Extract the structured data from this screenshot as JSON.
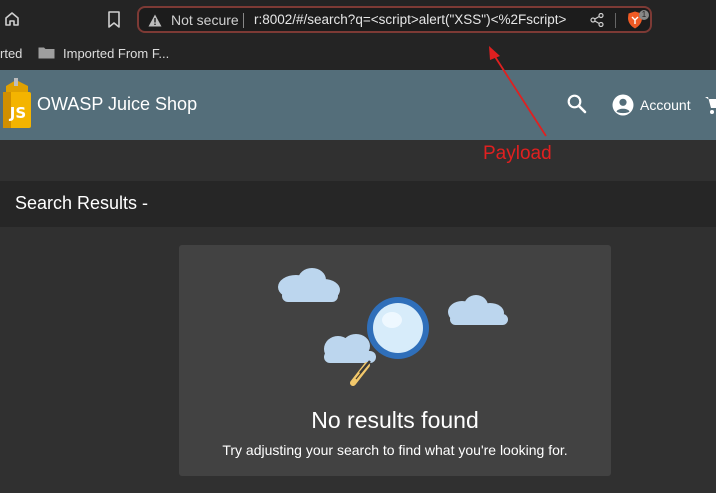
{
  "browser": {
    "security_label": "Not secure",
    "url": "r:8002/#/search?q=<script>alert(\"XSS\")<%2Fscript>",
    "shields_badge": "1",
    "bookmarks": {
      "partial_item": "rted",
      "folder_label": "Imported From F..."
    }
  },
  "app": {
    "title": "OWASP Juice Shop",
    "logo_text": "JS",
    "account_label": "Account",
    "toolbar_color": "#546e7a"
  },
  "annotation": {
    "label": "Payload",
    "color": "#e02020"
  },
  "results": {
    "heading": "Search Results -",
    "empty_title": "No results found",
    "empty_subtitle": "Try adjusting your search to find what you're looking for."
  },
  "icons": [
    "home-icon",
    "bookmark-icon",
    "warning-icon",
    "share-icon",
    "brave-shield-icon",
    "folder-icon",
    "search-icon",
    "account-icon",
    "cart-icon",
    "magnifier-illustration",
    "cloud-icon"
  ]
}
